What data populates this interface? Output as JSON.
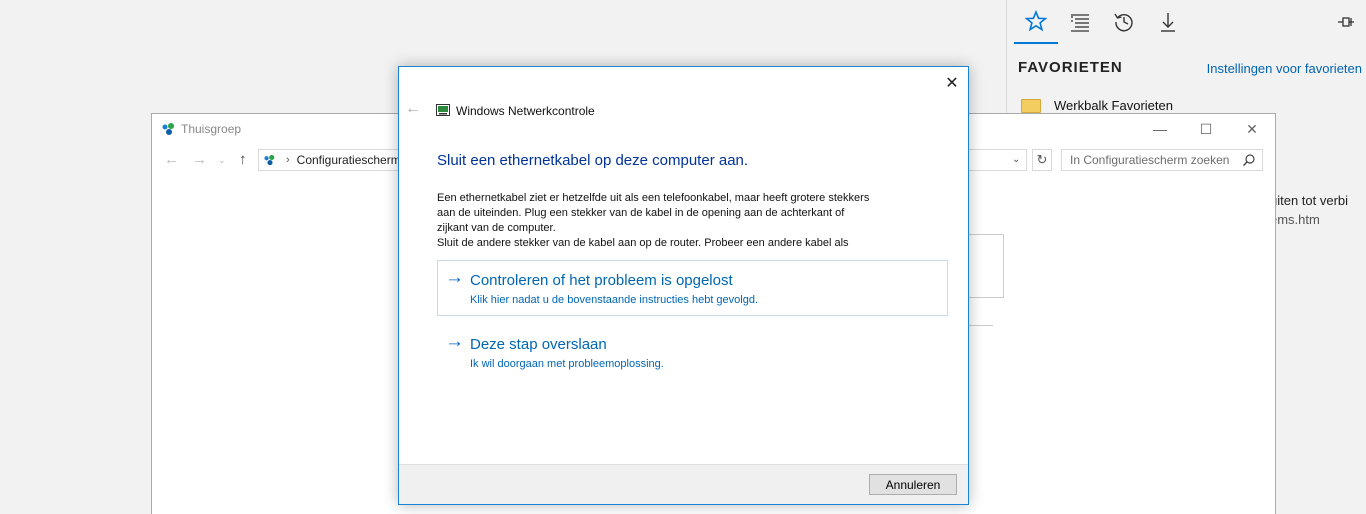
{
  "hub": {
    "title": "FAVORIETEN",
    "settings_link": "Instellingen voor favorieten",
    "favorites": [
      {
        "label": "Werkbalk Favorieten",
        "icon": "folder-icon"
      }
    ],
    "fragment_line1": "uiten tot verbi",
    "fragment_line2": "ems.htm",
    "tabs": [
      "favorites-star-icon",
      "reading-list-icon",
      "history-icon",
      "downloads-icon"
    ],
    "accent_color": "#0078d7"
  },
  "explorer": {
    "title": "Thuisgroep",
    "address_crumb": "Configuratiescherm",
    "search_placeholder": "In Configuratiescherm zoeken",
    "caption_min": "—",
    "caption_max": "☐",
    "caption_close": "✕"
  },
  "dialog": {
    "app_title": "Windows Netwerkcontrole",
    "heading": "Sluit een ethernetkabel op deze computer aan.",
    "body_lines": [
      "Een ethernetkabel ziet er hetzelfde uit als een telefoonkabel, maar heeft grotere stekkers",
      "aan de uiteinden. Plug een stekker van de kabel in de opening aan de achterkant of",
      "zijkant van de computer.",
      "Sluit de andere stekker van de kabel aan op de router. Probeer een andere kabel als"
    ],
    "commands": [
      {
        "title": "Controleren of het probleem is opgelost",
        "subtitle": "Klik hier nadat u de bovenstaande instructies hebt gevolgd."
      },
      {
        "title": "Deze stap overslaan",
        "subtitle": "Ik wil doorgaan met probleemoplossing."
      }
    ],
    "cancel_label": "Annuleren",
    "close_glyph": "✕",
    "back_glyph": "←",
    "arrow_glyph": "→",
    "link_color": "#0066b4",
    "heading_color": "#003399"
  }
}
